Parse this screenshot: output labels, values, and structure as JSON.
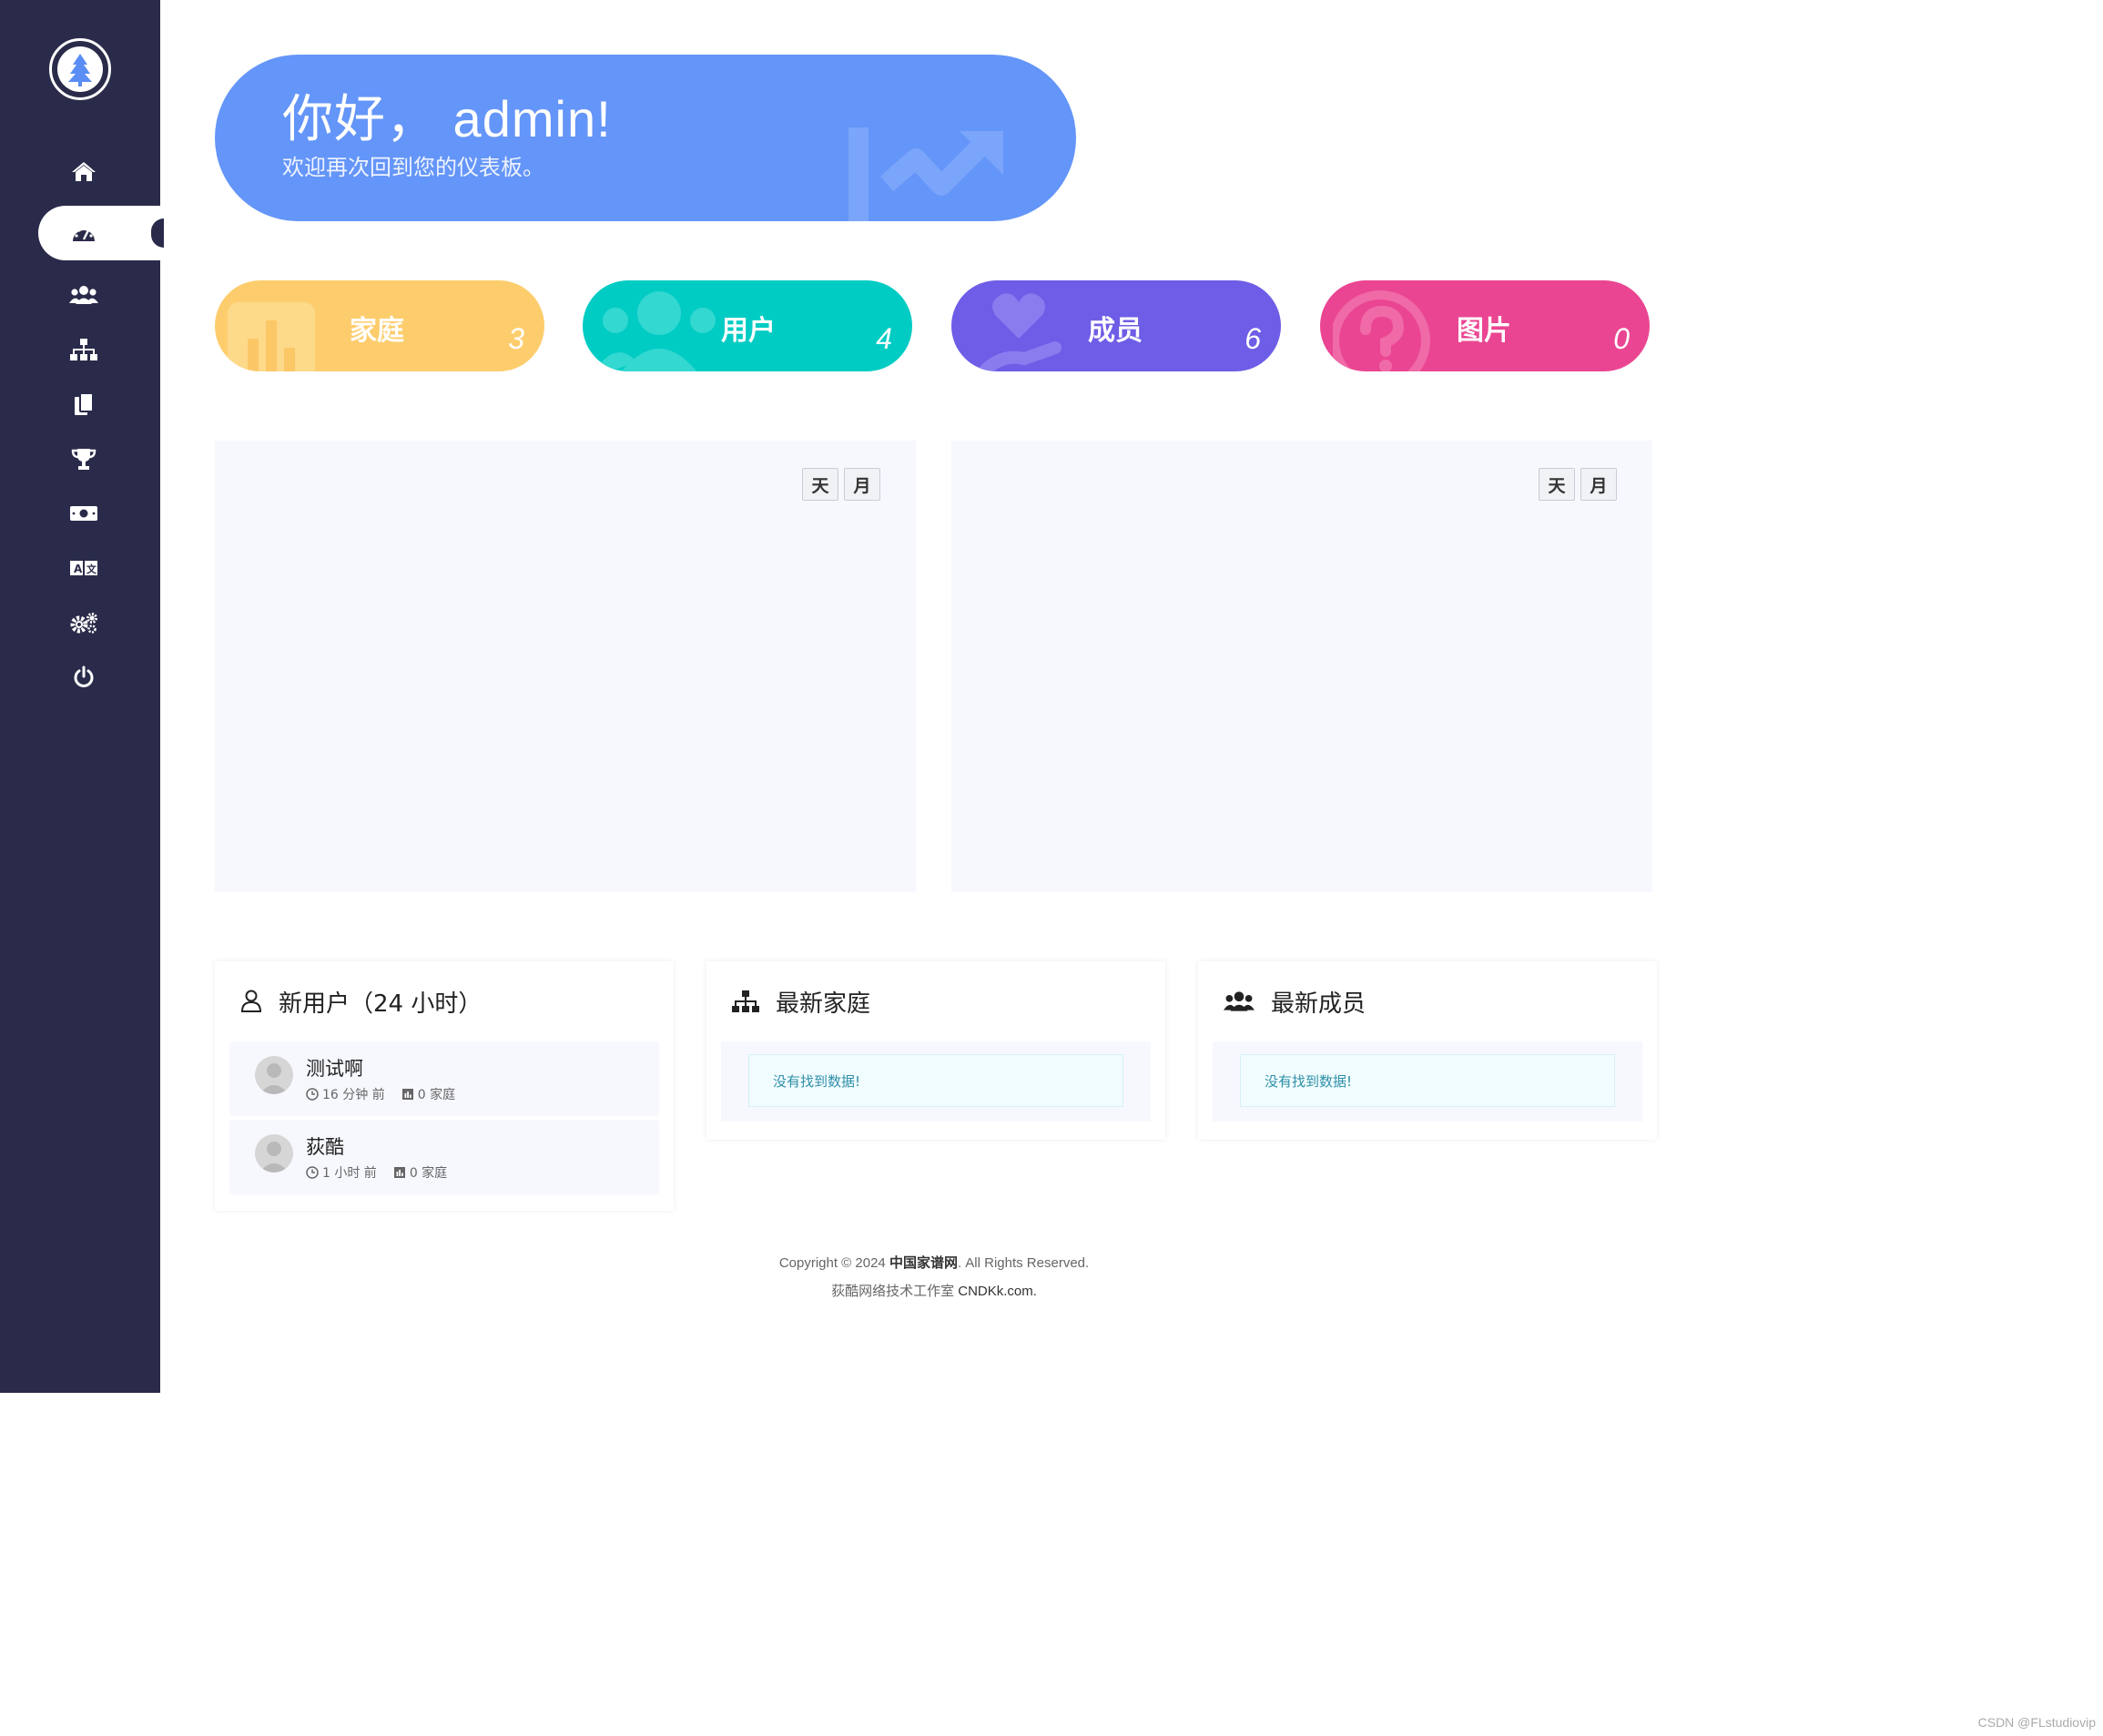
{
  "hero": {
    "title": "你好， admin!",
    "subtitle": "欢迎再次回到您的仪表板。"
  },
  "stats": [
    {
      "label": "家庭",
      "value": "3",
      "color": "#fdcd6d"
    },
    {
      "label": "用户",
      "value": "4",
      "color": "#00ccc4"
    },
    {
      "label": "成员",
      "value": "6",
      "color": "#6e5de6"
    },
    {
      "label": "图片",
      "value": "0",
      "color": "#ea4592"
    }
  ],
  "charts": [
    {
      "day": "天",
      "month": "月"
    },
    {
      "day": "天",
      "month": "月"
    }
  ],
  "new_users": {
    "title": "新用户（24 小时）",
    "rows": [
      {
        "name": "测试啊",
        "time": "16 分钟 前",
        "families": "0 家庭"
      },
      {
        "name": "荻酷",
        "time": "1 小时 前",
        "families": "0 家庭"
      }
    ]
  },
  "latest_families": {
    "title": "最新家庭",
    "empty": "没有找到数据!"
  },
  "latest_members": {
    "title": "最新成员",
    "empty": "没有找到数据!"
  },
  "footer": {
    "line1_prefix": "Copyright © 2024 ",
    "line1_brand": "中国家谱网",
    "line1_suffix": ". All Rights Reserved.",
    "line2_prefix": "荻酷网络技术工作室 ",
    "line2_brand": "CNDKk.com."
  },
  "watermark": "CSDN @FLstudiovip"
}
